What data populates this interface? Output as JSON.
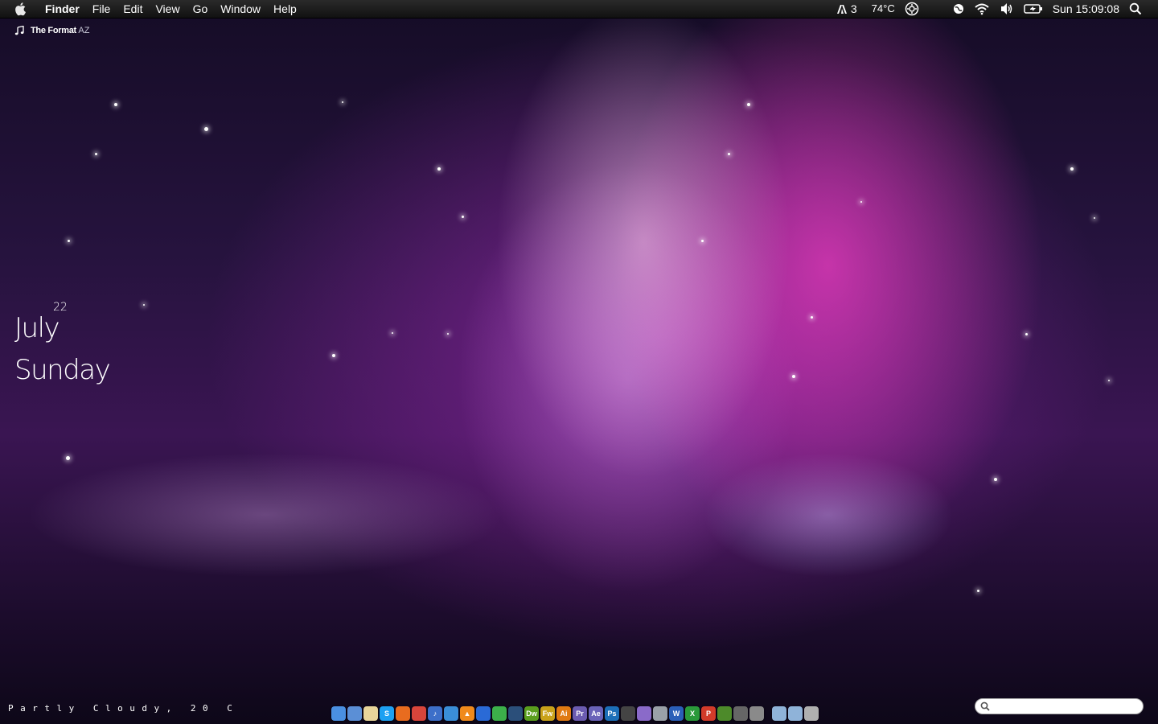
{
  "menubar": {
    "app_name": "Finder",
    "menus": [
      "File",
      "Edit",
      "View",
      "Go",
      "Window",
      "Help"
    ],
    "status": {
      "adobe_count": "3",
      "temperature": "74°C",
      "clock": "Sun 15:09:08"
    }
  },
  "now_playing": {
    "artist": "The Format",
    "album": "AZ"
  },
  "date_widget": {
    "day": "22",
    "month": "July",
    "weekday": "Sunday"
  },
  "weather": {
    "text": "Partly Cloudy, 20 C"
  },
  "dock": {
    "apps": [
      {
        "name": "finder-icon",
        "label": "",
        "color": "#4a90e2"
      },
      {
        "name": "mail-icon",
        "label": "",
        "color": "#5b8fd6"
      },
      {
        "name": "notes-icon",
        "label": "",
        "color": "#e8d59a"
      },
      {
        "name": "skype-icon",
        "label": "S",
        "color": "#1da1f2"
      },
      {
        "name": "firefox-icon",
        "label": "",
        "color": "#e86c1f"
      },
      {
        "name": "chrome-icon",
        "label": "",
        "color": "#d9453b"
      },
      {
        "name": "itunes-icon",
        "label": "♪",
        "color": "#3d6fc9"
      },
      {
        "name": "safari-icon",
        "label": "",
        "color": "#3a8ed8"
      },
      {
        "name": "vlc-icon",
        "label": "▲",
        "color": "#f08a1c"
      },
      {
        "name": "xcode-icon",
        "label": "",
        "color": "#2a6ad6"
      },
      {
        "name": "app-green-icon",
        "label": "",
        "color": "#3cb04a"
      },
      {
        "name": "app-dark-icon",
        "label": "",
        "color": "#2b4f7a"
      },
      {
        "name": "dreamweaver-icon",
        "label": "Dw",
        "color": "#5a9e1e"
      },
      {
        "name": "fireworks-icon",
        "label": "Fw",
        "color": "#c9a21a"
      },
      {
        "name": "illustrator-icon",
        "label": "Ai",
        "color": "#e07a12"
      },
      {
        "name": "premiere-icon",
        "label": "Pr",
        "color": "#6b5bb0"
      },
      {
        "name": "after-effects-icon",
        "label": "Ae",
        "color": "#6a63b8"
      },
      {
        "name": "photoshop-icon",
        "label": "Ps",
        "color": "#1c6fb8"
      },
      {
        "name": "final-cut-icon",
        "label": "",
        "color": "#444"
      },
      {
        "name": "keynote-icon",
        "label": "",
        "color": "#8a6ac9"
      },
      {
        "name": "disk-utility-icon",
        "label": "",
        "color": "#9aa0a8"
      },
      {
        "name": "word-icon",
        "label": "W",
        "color": "#2a5fb8"
      },
      {
        "name": "excel-icon",
        "label": "X",
        "color": "#2a9a3a"
      },
      {
        "name": "powerpoint-icon",
        "label": "P",
        "color": "#d23b2a"
      },
      {
        "name": "minecraft-icon",
        "label": "",
        "color": "#4d8a2a"
      },
      {
        "name": "utility-icon",
        "label": "",
        "color": "#666"
      },
      {
        "name": "system-prefs-icon",
        "label": "",
        "color": "#8a8a8a"
      },
      {
        "name": "applications-folder-icon",
        "label": "",
        "color": "#8fb3d9"
      },
      {
        "name": "documents-folder-icon",
        "label": "",
        "color": "#8fb3d9"
      },
      {
        "name": "trash-icon",
        "label": "",
        "color": "#b0b0b0"
      }
    ]
  },
  "search": {
    "placeholder": ""
  }
}
